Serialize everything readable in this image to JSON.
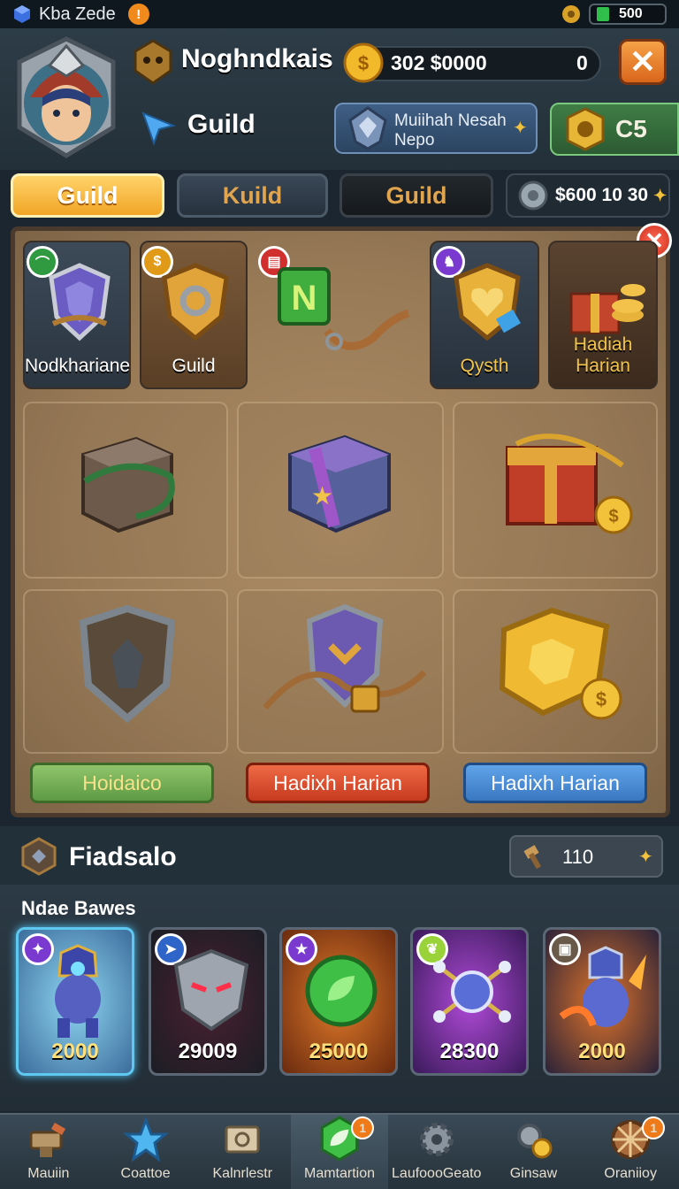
{
  "status_bar": {
    "app_name": "Kba Zede",
    "warning": "!",
    "currency": "500"
  },
  "header": {
    "player_name": "Noghndkais",
    "coins": "302 $0000",
    "coins_extra": "0",
    "close": "✕",
    "guild_title": "Guild",
    "guild_panel": {
      "line1": "Muiihah Nesah",
      "line2": "Nepo"
    },
    "c5": "C5"
  },
  "tabs": [
    {
      "label": "Guild",
      "active": true
    },
    {
      "label": "Kuild"
    },
    {
      "label": "Guild"
    },
    {
      "label": "$600 10 30"
    }
  ],
  "top_cards": [
    {
      "label": "Nodkhariane",
      "icon": "shield-chain-icon"
    },
    {
      "label": "Guild",
      "icon": "crest-icon"
    },
    {
      "label": "",
      "icon": "n-block-rope-icon"
    },
    {
      "label": "Qysth",
      "icon": "heart-crest-icon"
    },
    {
      "label": "Hadiah Harian",
      "icon": "gold-chest-icon"
    }
  ],
  "board": {
    "close": "✕"
  },
  "buttons": [
    {
      "label": "Hoidaico",
      "color": "#6fa356"
    },
    {
      "label": "Hadixh Harian",
      "color": "#d9472a"
    },
    {
      "label": "Hadixh Harian",
      "color": "#3f7ec7"
    }
  ],
  "section": {
    "title": "Fiadsalo",
    "value": "110"
  },
  "shelf": {
    "title": "Ndae Bawes",
    "items": [
      {
        "price": "2000",
        "icon": "knight-hero-icon"
      },
      {
        "price": "29009",
        "icon": "armor-helmet-icon"
      },
      {
        "price": "25000",
        "icon": "green-orb-icon"
      },
      {
        "price": "28300",
        "icon": "purple-orb-icon"
      },
      {
        "price": "2000",
        "icon": "flame-knight-icon"
      }
    ]
  },
  "nav": [
    {
      "label": "Mauiin",
      "icon": "anvil-icon"
    },
    {
      "label": "Coattoe",
      "icon": "star-crystal-icon"
    },
    {
      "label": "Kalnrlestr",
      "icon": "scroll-map-icon"
    },
    {
      "label": "Mamtartion",
      "icon": "green-leaf-icon",
      "badge": "1"
    },
    {
      "label": "LaufoooGeato",
      "icon": "gear-icon"
    },
    {
      "label": "Ginsaw",
      "icon": "gear-coin-icon"
    },
    {
      "label": "Oraniioy",
      "icon": "wheel-icon",
      "badge": "1"
    }
  ]
}
